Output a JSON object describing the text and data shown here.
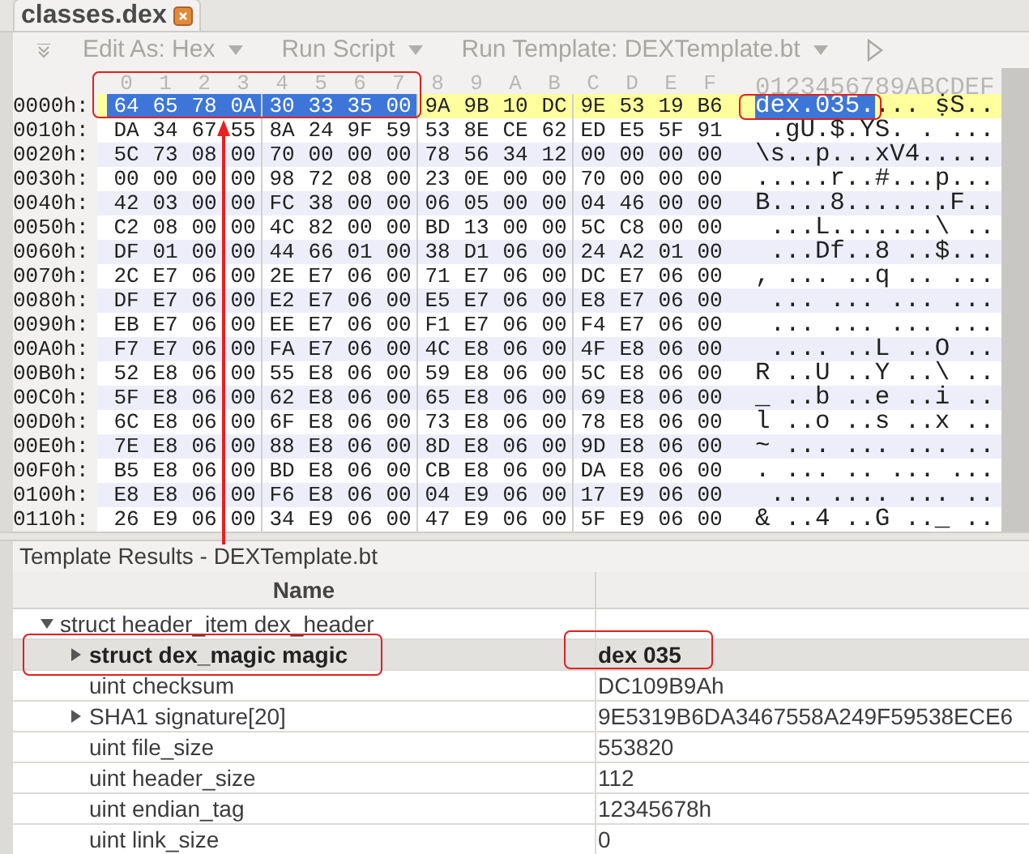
{
  "tab": {
    "title": "classes.dex"
  },
  "toolbar": [
    {
      "kind": "dropdown",
      "label": "Edit As: Hex"
    },
    {
      "kind": "dropdown",
      "label": "Run Script"
    },
    {
      "kind": "dropdown",
      "label": "Run Template: DEXTemplate.bt"
    },
    {
      "kind": "play"
    }
  ],
  "hex_view": {
    "column_headers": [
      "0",
      "1",
      "2",
      "3",
      "4",
      "5",
      "6",
      "7",
      "8",
      "9",
      "A",
      "B",
      "C",
      "D",
      "E",
      "F"
    ],
    "ascii_header": "0123456789ABCDEF",
    "rows": [
      {
        "address": "0000h:",
        "current": true,
        "bytes_selected": [
          "64",
          "65",
          "78",
          "0A",
          "30",
          "33",
          "35",
          "00"
        ],
        "bytes": [
          "9A",
          "9B",
          "10",
          "DC",
          "9E",
          "53",
          "19",
          "B6"
        ],
        "ascii_selected": "dex.035.",
        "ascii": "... ṩS.."
      },
      {
        "address": "0010h:",
        "current": false,
        "bytes": [
          "DA",
          "34",
          "67",
          "55",
          "8A",
          "24",
          "9F",
          "59",
          "53",
          "8E",
          "CE",
          "62",
          "ED",
          "E5",
          "5F",
          "91"
        ],
        "ascii": " .gU.$.YS. . ..."
      },
      {
        "address": "0020h:",
        "current": false,
        "bytes": [
          "5C",
          "73",
          "08",
          "00",
          "70",
          "00",
          "00",
          "00",
          "78",
          "56",
          "34",
          "12",
          "00",
          "00",
          "00",
          "00"
        ],
        "ascii": "\\s..p...xV4....."
      },
      {
        "address": "0030h:",
        "current": false,
        "bytes": [
          "00",
          "00",
          "00",
          "00",
          "98",
          "72",
          "08",
          "00",
          "23",
          "0E",
          "00",
          "00",
          "70",
          "00",
          "00",
          "00"
        ],
        "ascii": ".....r..#...p..."
      },
      {
        "address": "0040h:",
        "current": false,
        "bytes": [
          "42",
          "03",
          "00",
          "00",
          "FC",
          "38",
          "00",
          "00",
          "06",
          "05",
          "00",
          "00",
          "04",
          "46",
          "00",
          "00"
        ],
        "ascii": "B....8.......F.."
      },
      {
        "address": "0050h:",
        "current": false,
        "bytes": [
          "C2",
          "08",
          "00",
          "00",
          "4C",
          "82",
          "00",
          "00",
          "BD",
          "13",
          "00",
          "00",
          "5C",
          "C8",
          "00",
          "00"
        ],
        "ascii": " ...L.......\\ .."
      },
      {
        "address": "0060h:",
        "current": false,
        "bytes": [
          "DF",
          "01",
          "00",
          "00",
          "44",
          "66",
          "01",
          "00",
          "38",
          "D1",
          "06",
          "00",
          "24",
          "A2",
          "01",
          "00"
        ],
        "ascii": " ...Df..8 ..$..."
      },
      {
        "address": "0070h:",
        "current": false,
        "bytes": [
          "2C",
          "E7",
          "06",
          "00",
          "2E",
          "E7",
          "06",
          "00",
          "71",
          "E7",
          "06",
          "00",
          "DC",
          "E7",
          "06",
          "00"
        ],
        "ascii": ", ... ..q .. ..."
      },
      {
        "address": "0080h:",
        "current": false,
        "bytes": [
          "DF",
          "E7",
          "06",
          "00",
          "E2",
          "E7",
          "06",
          "00",
          "E5",
          "E7",
          "06",
          "00",
          "E8",
          "E7",
          "06",
          "00"
        ],
        "ascii": " ... ... ... ..."
      },
      {
        "address": "0090h:",
        "current": false,
        "bytes": [
          "EB",
          "E7",
          "06",
          "00",
          "EE",
          "E7",
          "06",
          "00",
          "F1",
          "E7",
          "06",
          "00",
          "F4",
          "E7",
          "06",
          "00"
        ],
        "ascii": " ... ... ... ..."
      },
      {
        "address": "00A0h:",
        "current": false,
        "bytes": [
          "F7",
          "E7",
          "06",
          "00",
          "FA",
          "E7",
          "06",
          "00",
          "4C",
          "E8",
          "06",
          "00",
          "4F",
          "E8",
          "06",
          "00"
        ],
        "ascii": " .... ..L ..O .."
      },
      {
        "address": "00B0h:",
        "current": false,
        "bytes": [
          "52",
          "E8",
          "06",
          "00",
          "55",
          "E8",
          "06",
          "00",
          "59",
          "E8",
          "06",
          "00",
          "5C",
          "E8",
          "06",
          "00"
        ],
        "ascii": "R ..U ..Y ..\\ .."
      },
      {
        "address": "00C0h:",
        "current": false,
        "bytes": [
          "5F",
          "E8",
          "06",
          "00",
          "62",
          "E8",
          "06",
          "00",
          "65",
          "E8",
          "06",
          "00",
          "69",
          "E8",
          "06",
          "00"
        ],
        "ascii": "_ ..b ..e ..i .."
      },
      {
        "address": "00D0h:",
        "current": false,
        "bytes": [
          "6C",
          "E8",
          "06",
          "00",
          "6F",
          "E8",
          "06",
          "00",
          "73",
          "E8",
          "06",
          "00",
          "78",
          "E8",
          "06",
          "00"
        ],
        "ascii": "l ..o ..s ..x .."
      },
      {
        "address": "00E0h:",
        "current": false,
        "bytes": [
          "7E",
          "E8",
          "06",
          "00",
          "88",
          "E8",
          "06",
          "00",
          "8D",
          "E8",
          "06",
          "00",
          "9D",
          "E8",
          "06",
          "00"
        ],
        "ascii": "~ ... ... ... .."
      },
      {
        "address": "00F0h:",
        "current": false,
        "bytes": [
          "B5",
          "E8",
          "06",
          "00",
          "BD",
          "E8",
          "06",
          "00",
          "CB",
          "E8",
          "06",
          "00",
          "DA",
          "E8",
          "06",
          "00"
        ],
        "ascii": ". ... .. ... ..."
      },
      {
        "address": "0100h:",
        "current": false,
        "bytes": [
          "E8",
          "E8",
          "06",
          "00",
          "F6",
          "E8",
          "06",
          "00",
          "04",
          "E9",
          "06",
          "00",
          "17",
          "E9",
          "06",
          "00"
        ],
        "ascii": " ... .... ... .."
      },
      {
        "address": "0110h:",
        "current": false,
        "bytes": [
          "26",
          "E9",
          "06",
          "00",
          "34",
          "E9",
          "06",
          "00",
          "47",
          "E9",
          "06",
          "00",
          "5F",
          "E9",
          "06",
          "00"
        ],
        "ascii": "& ..4 ..G .._ .."
      }
    ]
  },
  "template_results": {
    "title": "Template Results - DEXTemplate.bt",
    "columns": [
      "Name"
    ],
    "rows": [
      {
        "name": "struct header_item dex_header",
        "expanded": true,
        "selected": false,
        "children": [
          {
            "name": "struct dex_magic magic",
            "value": "dex 035",
            "expanded": false,
            "selected": true
          },
          {
            "name": "uint checksum",
            "value": "DC109B9Ah",
            "selected": false
          },
          {
            "name": "SHA1 signature[20]",
            "value": "9E5319B6DA3467558A249F59538ECE6",
            "expanded": false,
            "selected": false
          },
          {
            "name": "uint file_size",
            "value": "553820",
            "selected": false
          },
          {
            "name": "uint header_size",
            "value": "112",
            "selected": false
          },
          {
            "name": "uint endian_tag",
            "value": "12345678h",
            "selected": false
          },
          {
            "name": "uint link_size",
            "value": "0",
            "selected": false
          }
        ]
      }
    ]
  }
}
